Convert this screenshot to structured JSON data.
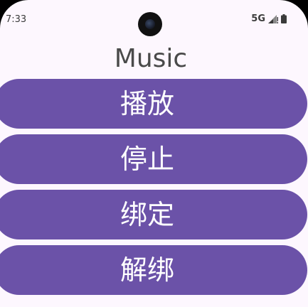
{
  "status_bar": {
    "time": "7:33",
    "network": "5G"
  },
  "app": {
    "title": "Music"
  },
  "buttons": {
    "play": "播放",
    "stop": "停止",
    "bind": "绑定",
    "unbind": "解绑"
  },
  "colors": {
    "background": "#fdf7fe",
    "button": "#6b52a8",
    "button_text": "#ffffff",
    "title_text": "#4a4a4a"
  },
  "icons": {
    "camera": "front-camera-icon",
    "signal": "signal-icon",
    "battery": "battery-icon"
  }
}
